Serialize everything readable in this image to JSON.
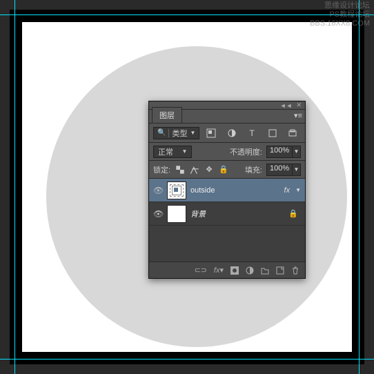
{
  "watermark": {
    "line1": "思缘设计论坛",
    "line2": "PS教程论坛",
    "line3": "BBS.16XX8.COM"
  },
  "panel": {
    "title": "图层",
    "filter": {
      "kind_label": "类型"
    },
    "blend_mode": "正常",
    "opacity": {
      "label": "不透明度:",
      "value": "100%"
    },
    "lock": {
      "label": "锁定:"
    },
    "fill": {
      "label": "填充:",
      "value": "100%"
    },
    "layers": [
      {
        "name": "outside",
        "selected": true,
        "has_fx": true,
        "fx_label": "fx"
      },
      {
        "name": "背景",
        "selected": false,
        "italic": true,
        "locked": true
      }
    ]
  }
}
